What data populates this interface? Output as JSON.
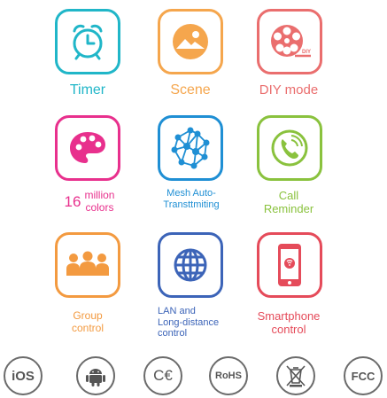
{
  "colors": {
    "cyan": "#20b6c8",
    "orange": "#f5a64d",
    "coral": "#ea6e6e",
    "magenta": "#e8308d",
    "blue": "#1f8fd4",
    "green": "#8ac23e",
    "group_orange": "#f39a40",
    "lan_blue": "#3c64b8",
    "red": "#e54b5a",
    "gray": "#666666"
  },
  "features": [
    {
      "icon": "alarm-clock-icon",
      "label": "Timer"
    },
    {
      "icon": "landscape-image-icon",
      "label": "Scene"
    },
    {
      "icon": "film-reel-icon",
      "label": "DIY mode",
      "badge": "DIY"
    },
    {
      "icon": "color-palette-icon",
      "number": "16",
      "label_line1": "million",
      "label_line2": "colors"
    },
    {
      "icon": "mesh-network-icon",
      "label_line1": "Mesh Auto-",
      "label_line2": "Transttmiting"
    },
    {
      "icon": "phone-call-icon",
      "label_line1": "Call",
      "label_line2": "Reminder"
    },
    {
      "icon": "group-people-icon",
      "label_line1": "Group",
      "label_line2": "control"
    },
    {
      "icon": "globe-icon",
      "label_line1": "LAN and",
      "label_line2": "Long-distance",
      "label_line3": "control"
    },
    {
      "icon": "smartphone-icon",
      "label_line1": "Smartphone",
      "label_line2": "control"
    }
  ],
  "certifications": [
    "iOS",
    "android-icon",
    "CE",
    "RoHS",
    "weee-bin-icon",
    "FCC"
  ],
  "cert_text": {
    "ios": "iOS",
    "ce": "C€",
    "rohs": "RoHS",
    "fcc": "FCC"
  }
}
